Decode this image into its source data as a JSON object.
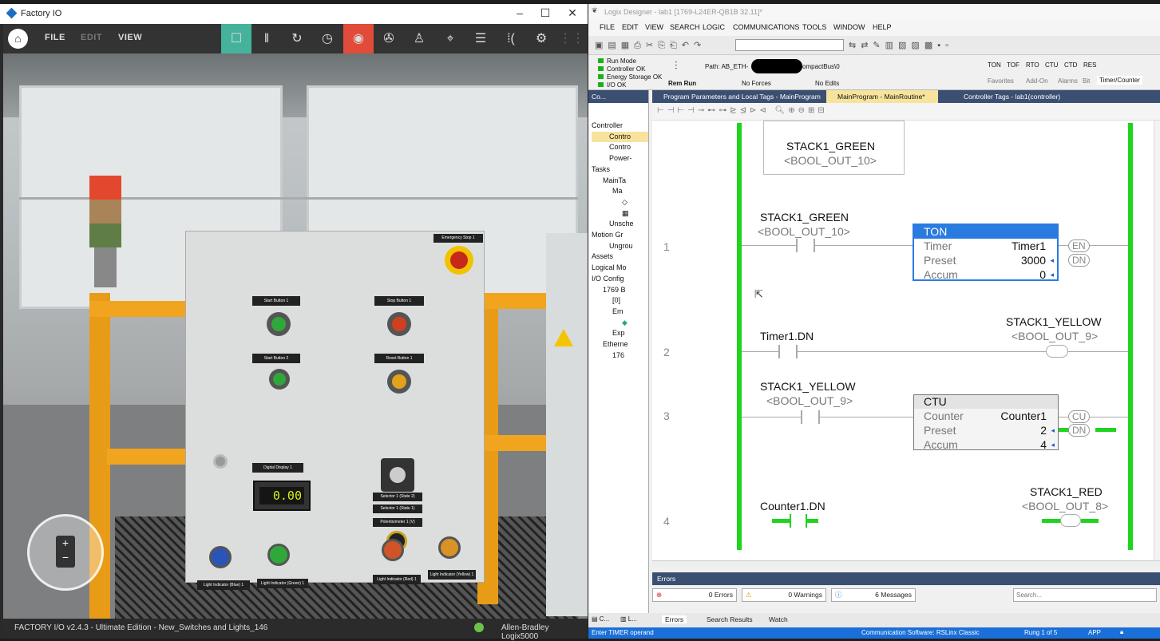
{
  "factoryio": {
    "window_title": "Factory IO",
    "menu": [
      "FILE",
      "EDIT",
      "VIEW"
    ],
    "panel": {
      "emergency_stop": "Emergency Stop 1",
      "start1": "Start Button 1",
      "stop1": "Stop Button 1",
      "start2": "Start Button 2",
      "reset1": "Reset Button 1",
      "digital_display": "Digital Display 1",
      "display_value": "0.00",
      "selector_2": "Selector 1 (State 2)",
      "selector_1": "Selector 1 (State 1)",
      "potentiometer": "Potentiometer 1 (V)",
      "light_blue": "Light Indicator (Blue) 1",
      "light_green": "Light Indicator (Green) 1",
      "light_red": "Light Indicator (Red) 1",
      "light_yellow": "Light Indicator (Yellow) 1"
    },
    "status_left": "FACTORY I/O v2.4.3 - Ultimate Edition - New_Switches and Lights_146",
    "status_right": "Allen-Bradley Logix5000"
  },
  "logix": {
    "window_title": "Logix Designer - lab1 [1769-L24ER-QB1B 32.11]*",
    "menu": [
      "FILE",
      "EDIT",
      "VIEW",
      "SEARCH",
      "LOGIC",
      "COMMUNICATIONS",
      "TOOLS",
      "WINDOW",
      "HELP"
    ],
    "controller_status": {
      "run_mode": "Run Mode",
      "controller_ok": "Controller OK",
      "energy": "Energy Storage OK",
      "io_ok": "I/O OK",
      "mode": "Rem Run",
      "forces": "No Forces",
      "edits": "No Edits",
      "path_prefix": "Path: AB_ETH-",
      "path_suffix": "ompactBus\\0"
    },
    "instr_buttons": [
      "TON",
      "TOF",
      "RTO",
      "CTU",
      "CTD",
      "RES"
    ],
    "instr_tabs": [
      "Favorites",
      "Add-On",
      "Alarms",
      "Bit",
      "Timer/Counter"
    ],
    "tabs": [
      "Program Parameters and Local Tags - MainProgram",
      "MainProgram - MainRoutine*",
      "Controller Tags - lab1(controller)"
    ],
    "tree_header": "Co...",
    "tree": [
      "Controller",
      "Contro",
      "Contro",
      "Power-",
      "Tasks",
      "MainTa",
      "Ma",
      "",
      "",
      "Unsche",
      "Motion Gr",
      "Ungrou",
      "Assets",
      "Logical Mo",
      "I/O Config",
      "1769 B",
      "[0]",
      "Em",
      "",
      "Exp",
      "Etherne",
      "176"
    ],
    "rungs": {
      "r0_tag": "STACK1_GREEN",
      "r0_alias": "<BOOL_OUT_10>",
      "r1_num": "1",
      "r1_tag": "STACK1_GREEN",
      "r1_alias": "<BOOL_OUT_10>",
      "ton": {
        "name": "TON",
        "timer_label": "Timer",
        "timer": "Timer1",
        "preset_label": "Preset",
        "preset": "3000",
        "accum_label": "Accum",
        "accum": "0",
        "en": "EN",
        "dn": "DN"
      },
      "r2_num": "2",
      "r2_tag": "Timer1.DN",
      "r2_out": "STACK1_YELLOW",
      "r2_out_alias": "<BOOL_OUT_9>",
      "r3_num": "3",
      "r3_tag": "STACK1_YELLOW",
      "r3_alias": "<BOOL_OUT_9>",
      "ctu": {
        "name": "CTU",
        "counter_label": "Counter",
        "counter": "Counter1",
        "preset_label": "Preset",
        "preset": "2",
        "accum_label": "Accum",
        "accum": "4",
        "cu": "CU",
        "dn": "DN"
      },
      "r4_num": "4",
      "r4_tag": "Counter1.DN",
      "r4_out": "STACK1_RED",
      "r4_out_alias": "<BOOL_OUT_8>"
    },
    "errors": {
      "title": "Errors",
      "errors": "0 Errors",
      "warnings": "0 Warnings",
      "messages": "6 Messages",
      "search_placeholder": "Search..."
    },
    "bottom_tabs": [
      "Errors",
      "Search Results",
      "Watch"
    ],
    "status": {
      "left": "Enter TIMER operand",
      "comm": "Communication Software: RSLinx Classic",
      "rung": "Rung 1 of 5",
      "app": "APP"
    }
  },
  "colors": {
    "rail_green": "#1fd41f",
    "tab_bar": "#3b4f72",
    "status_blue": "#1a6fd8",
    "fio_record": "#e04b3a",
    "fio_active": "#45b39b"
  }
}
